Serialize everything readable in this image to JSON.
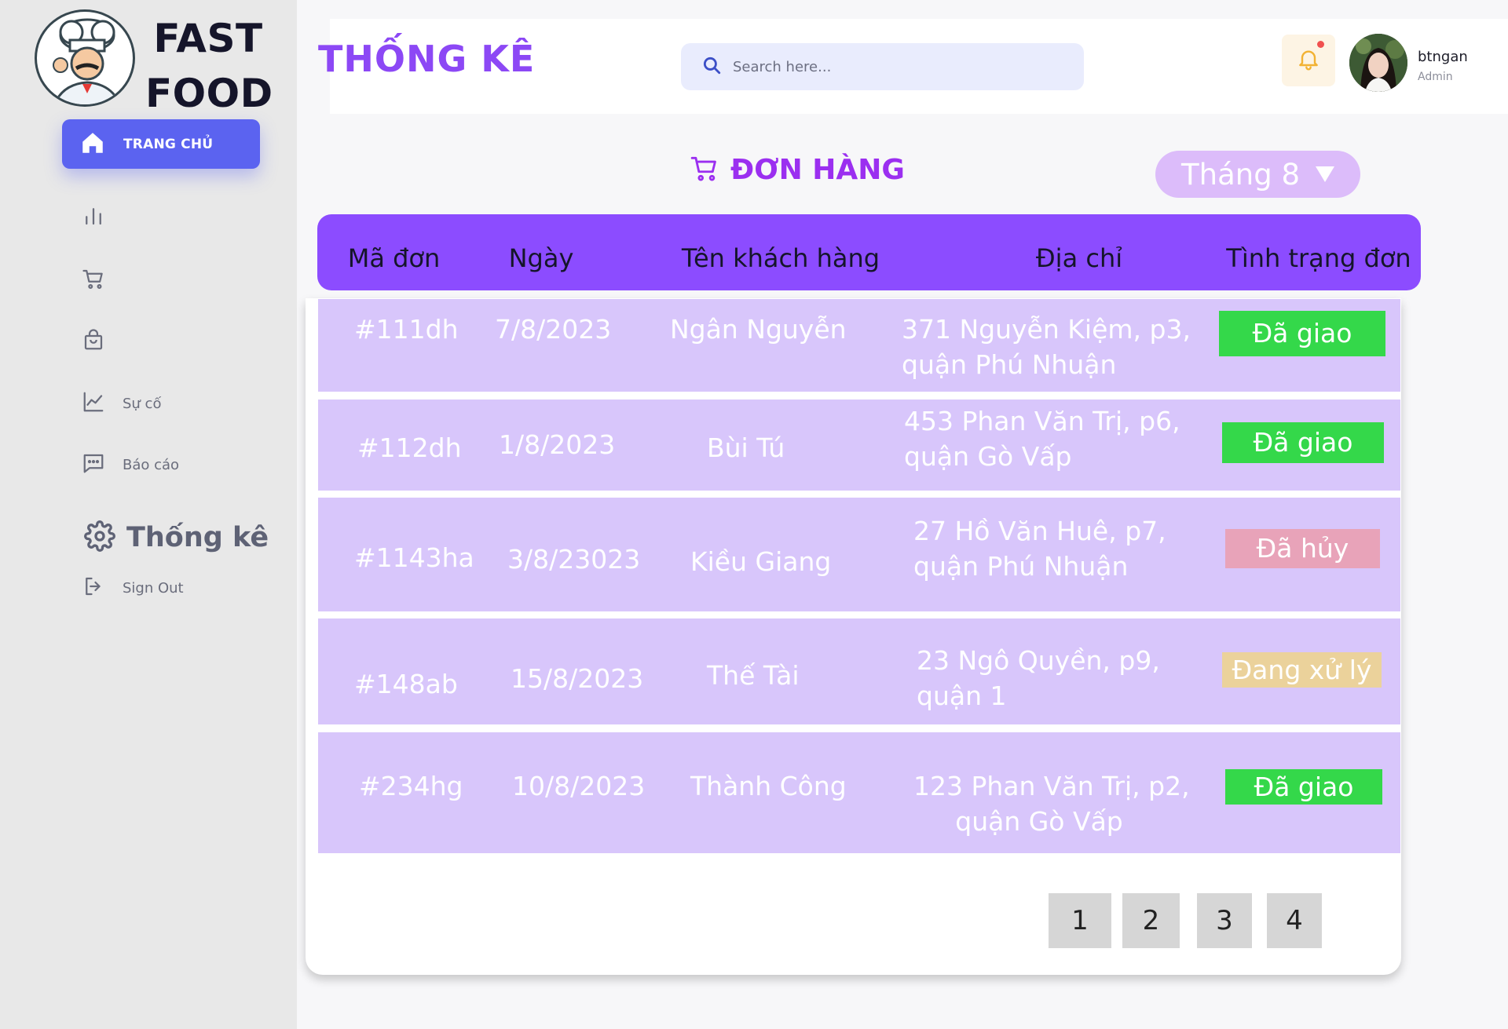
{
  "brand": {
    "line1": "FAST",
    "line2": "FOOD"
  },
  "sidebar": {
    "home_label": "TRANG CHỦ",
    "items": [
      {
        "icon": "bar-chart-icon",
        "label": ""
      },
      {
        "icon": "cart-icon",
        "label": ""
      },
      {
        "icon": "bag-icon",
        "label": ""
      },
      {
        "icon": "line-chart-icon",
        "label": "Sự cố"
      },
      {
        "icon": "message-icon",
        "label": "Báo cáo"
      },
      {
        "icon": "gear-icon",
        "label": "Thống kê"
      },
      {
        "icon": "sign-out-icon",
        "label": "Sign Out"
      }
    ]
  },
  "header": {
    "title": "THỐNG KÊ",
    "search_placeholder": "Search here...",
    "user_name": "btngan",
    "user_role": "Admin"
  },
  "orders": {
    "title": "ĐƠN HÀNG",
    "month": "Tháng 8",
    "columns": [
      "Mã đơn",
      "Ngày",
      "Tên khách hàng",
      "Địa chỉ",
      "Tình trạng đơn"
    ],
    "rows": [
      {
        "id": "#111dh",
        "date": "7/8/2023",
        "customer": "Ngân Nguyễn",
        "addr1": "371 Nguyễn Kiệm, p3,",
        "addr2": "quận Phú Nhuận",
        "status": "Đã giao"
      },
      {
        "id": "#112dh",
        "date": "1/8/2023",
        "customer": "Bùi Tú",
        "addr1": "453 Phan Văn Trị, p6,",
        "addr2": "quận Gò Vấp",
        "status": "Đã giao"
      },
      {
        "id": "#1143ha",
        "date": "3/8/23023",
        "customer": "Kiều Giang",
        "addr1": "27 Hồ Văn Huê, p7,",
        "addr2": "quận Phú Nhuận",
        "status": "Đã hủy"
      },
      {
        "id": "#148ab",
        "date": "15/8/2023",
        "customer": "Thế Tài",
        "addr1": "23 Ngô Quyền, p9,",
        "addr2": "quận 1",
        "status": "Đang xử lý"
      },
      {
        "id": "#234hg",
        "date": "10/8/2023",
        "customer": "Thành Công",
        "addr1": "123 Phan Văn Trị, p2,",
        "addr2": "quận Gò Vấp",
        "status": "Đã giao"
      }
    ],
    "pages": [
      "1",
      "2",
      "3",
      "4"
    ]
  },
  "colors": {
    "accent": "#8c4cff",
    "title": "#8c48f5",
    "row_bg": "#d8c6fb",
    "delivered": "#34d84a",
    "cancelled": "#e8a3b9",
    "processing": "#ebd29b"
  }
}
